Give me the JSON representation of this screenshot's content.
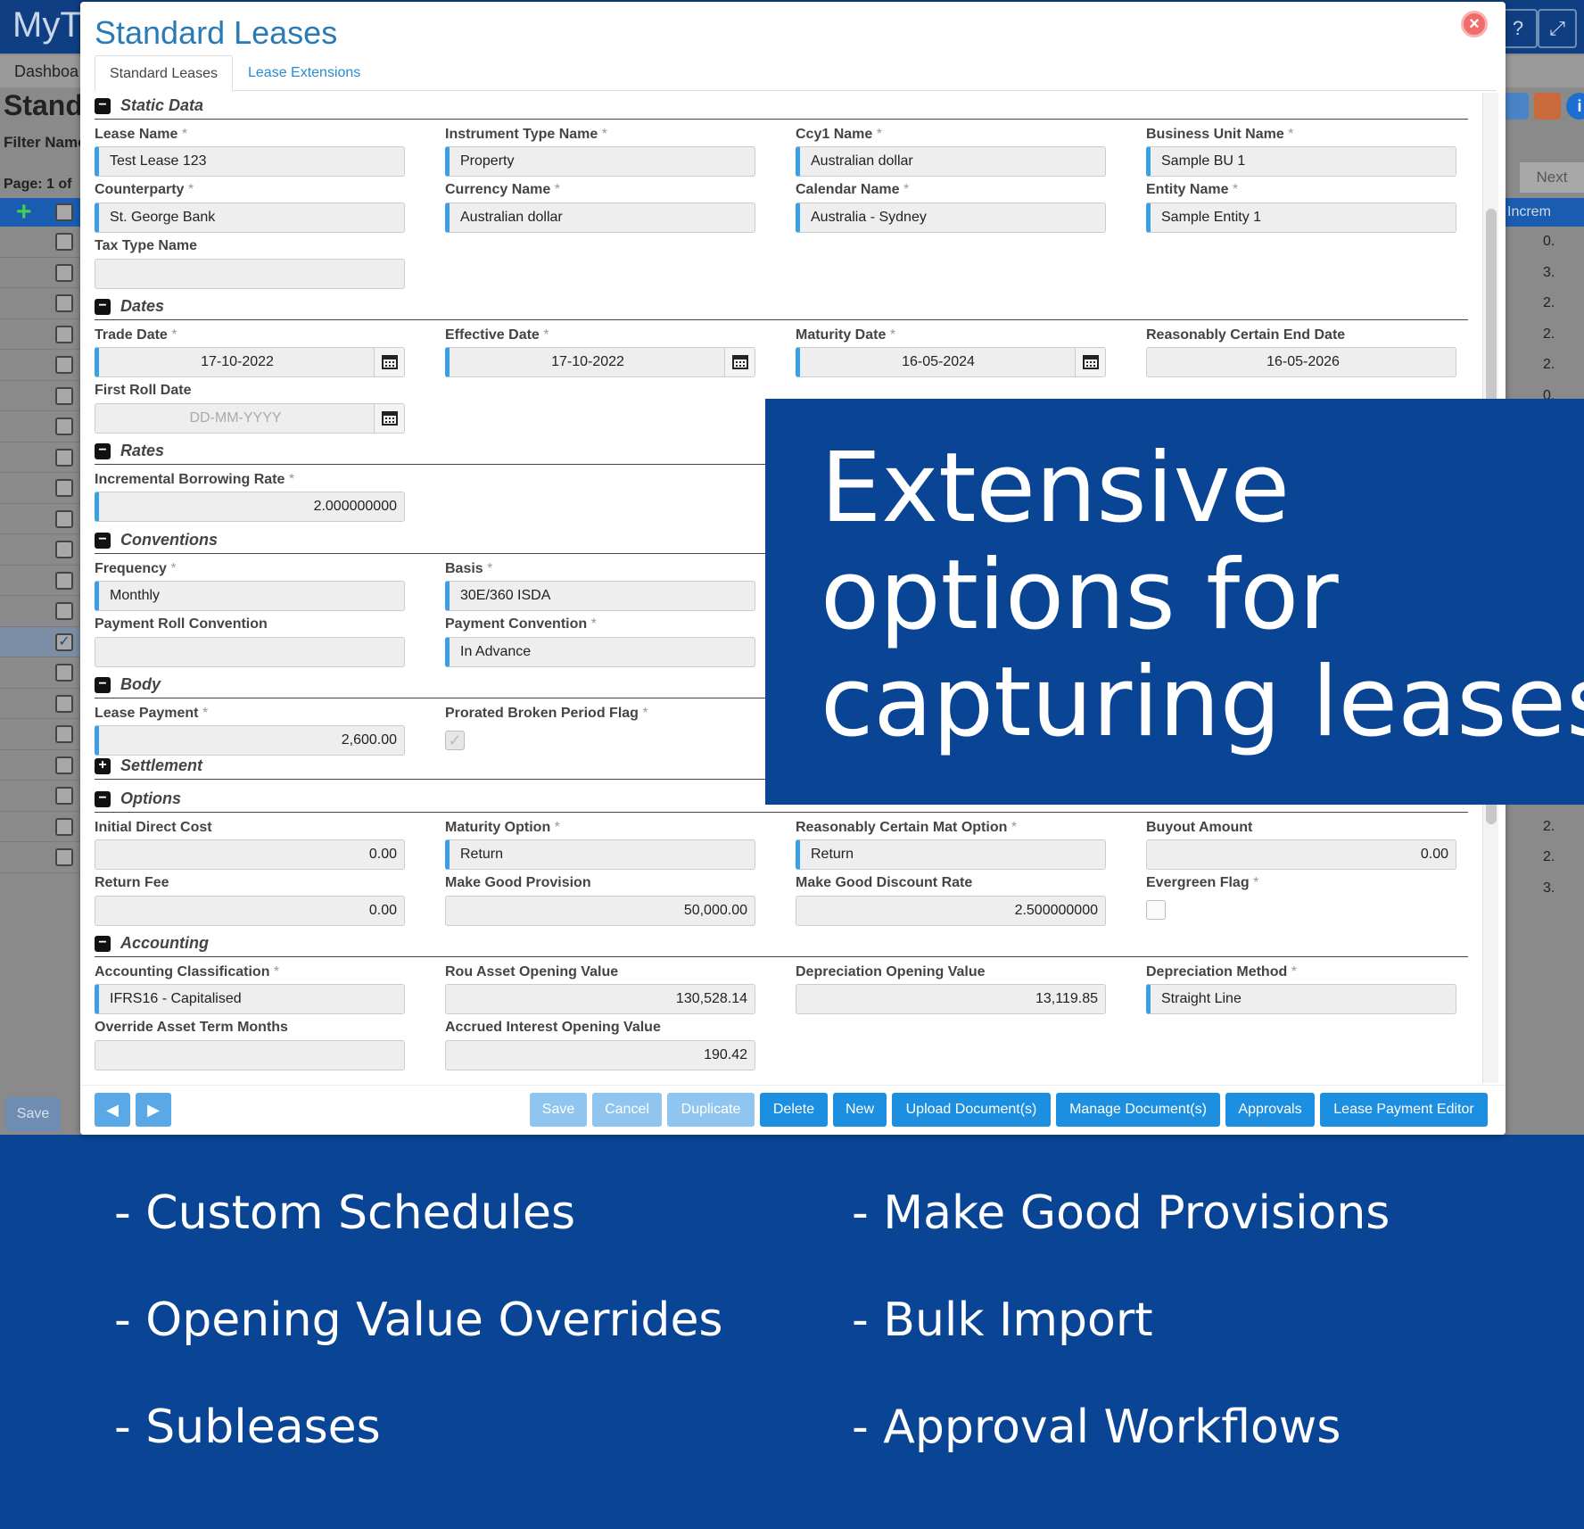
{
  "background_app": {
    "logo": "MyT",
    "menu": "Dashboa",
    "title": "Stand",
    "filter_label": "Filter Name",
    "page_label": "Page: 1 of",
    "next_label": "Next",
    "column_header": "Increm",
    "save_label": "Save",
    "right_values": [
      "0.",
      "3.",
      "2.",
      "2.",
      "2.",
      "0.",
      "2.",
      "2.",
      "3."
    ]
  },
  "modal": {
    "title": "Standard Leases",
    "tabs": [
      {
        "label": "Standard Leases",
        "active": true
      },
      {
        "label": "Lease Extensions",
        "active": false
      }
    ]
  },
  "sections": {
    "static_data": "Static Data",
    "dates": "Dates",
    "rates": "Rates",
    "conventions": "Conventions",
    "body": "Body",
    "settlement": "Settlement",
    "options": "Options",
    "accounting": "Accounting"
  },
  "fields": {
    "lease_name": {
      "label": "Lease Name",
      "value": "Test Lease 123"
    },
    "instrument_type_name": {
      "label": "Instrument Type Name",
      "value": "Property"
    },
    "ccy1_name": {
      "label": "Ccy1 Name",
      "value": "Australian dollar"
    },
    "business_unit_name": {
      "label": "Business Unit Name",
      "value": "Sample BU 1"
    },
    "counterparty": {
      "label": "Counterparty",
      "value": "St. George Bank"
    },
    "currency_name": {
      "label": "Currency Name",
      "value": "Australian dollar"
    },
    "calendar_name": {
      "label": "Calendar Name",
      "value": "Australia - Sydney"
    },
    "entity_name": {
      "label": "Entity Name",
      "value": "Sample Entity 1"
    },
    "tax_type_name": {
      "label": "Tax Type Name",
      "value": ""
    },
    "trade_date": {
      "label": "Trade Date",
      "value": "17-10-2022"
    },
    "effective_date": {
      "label": "Effective Date",
      "value": "17-10-2022"
    },
    "maturity_date": {
      "label": "Maturity Date",
      "value": "16-05-2024"
    },
    "reasonably_certain_end_date": {
      "label": "Reasonably Certain End Date",
      "value": "16-05-2026"
    },
    "first_roll_date": {
      "label": "First Roll Date",
      "placeholder": "DD-MM-YYYY"
    },
    "incremental_borrowing_rate": {
      "label": "Incremental Borrowing Rate",
      "value": "2.000000000"
    },
    "frequency": {
      "label": "Frequency",
      "value": "Monthly"
    },
    "basis": {
      "label": "Basis",
      "value": "30E/360 ISDA"
    },
    "payment_roll_convention": {
      "label": "Payment Roll Convention",
      "value": ""
    },
    "payment_convention": {
      "label": "Payment Convention",
      "value": "In Advance"
    },
    "lease_payment": {
      "label": "Lease Payment",
      "value": "2,600.00"
    },
    "prorated_broken_period_flag": {
      "label": "Prorated Broken Period Flag",
      "checked": true
    },
    "initial_direct_cost": {
      "label": "Initial Direct Cost",
      "value": "0.00"
    },
    "maturity_option": {
      "label": "Maturity Option",
      "value": "Return"
    },
    "reasonably_certain_mat_option": {
      "label": "Reasonably Certain Mat Option",
      "value": "Return"
    },
    "buyout_amount": {
      "label": "Buyout Amount",
      "value": "0.00"
    },
    "return_fee": {
      "label": "Return Fee",
      "value": "0.00"
    },
    "make_good_provision": {
      "label": "Make Good Provision",
      "value": "50,000.00"
    },
    "make_good_discount_rate": {
      "label": "Make Good Discount Rate",
      "value": "2.500000000"
    },
    "evergreen_flag": {
      "label": "Evergreen Flag",
      "checked": false
    },
    "accounting_classification": {
      "label": "Accounting Classification",
      "value": "IFRS16 - Capitalised"
    },
    "rou_asset_opening_value": {
      "label": "Rou Asset Opening Value",
      "value": "130,528.14"
    },
    "depreciation_opening_value": {
      "label": "Depreciation Opening Value",
      "value": "13,119.85"
    },
    "depreciation_method": {
      "label": "Depreciation Method",
      "value": "Straight Line"
    },
    "override_asset_term_months": {
      "label": "Override Asset Term Months",
      "value": ""
    },
    "accrued_interest_opening_value": {
      "label": "Accrued Interest Opening Value",
      "value": "190.42"
    }
  },
  "required_marker": "*",
  "footer": {
    "save": "Save",
    "cancel": "Cancel",
    "duplicate": "Duplicate",
    "delete": "Delete",
    "new": "New",
    "upload_documents": "Upload Document(s)",
    "manage_documents": "Manage Document(s)",
    "approvals": "Approvals",
    "lease_payment_editor": "Lease Payment Editor"
  },
  "banner": {
    "line1": "Extensive",
    "line2": "options for",
    "line3": "capturing leases"
  },
  "features": {
    "custom_schedules": "- Custom Schedules",
    "make_good_provisions": "- Make Good Provisions",
    "opening_value_overrides": "- Opening Value Overrides",
    "bulk_import": "- Bulk Import",
    "subleases": "- Subleases",
    "approval_workflows": "- Approval Workflows"
  },
  "colors": {
    "brand_blue": "#0a4494",
    "title_blue": "#2a7ab5",
    "button_blue": "#1c8fe0",
    "field_accent": "#3aa0e6"
  }
}
